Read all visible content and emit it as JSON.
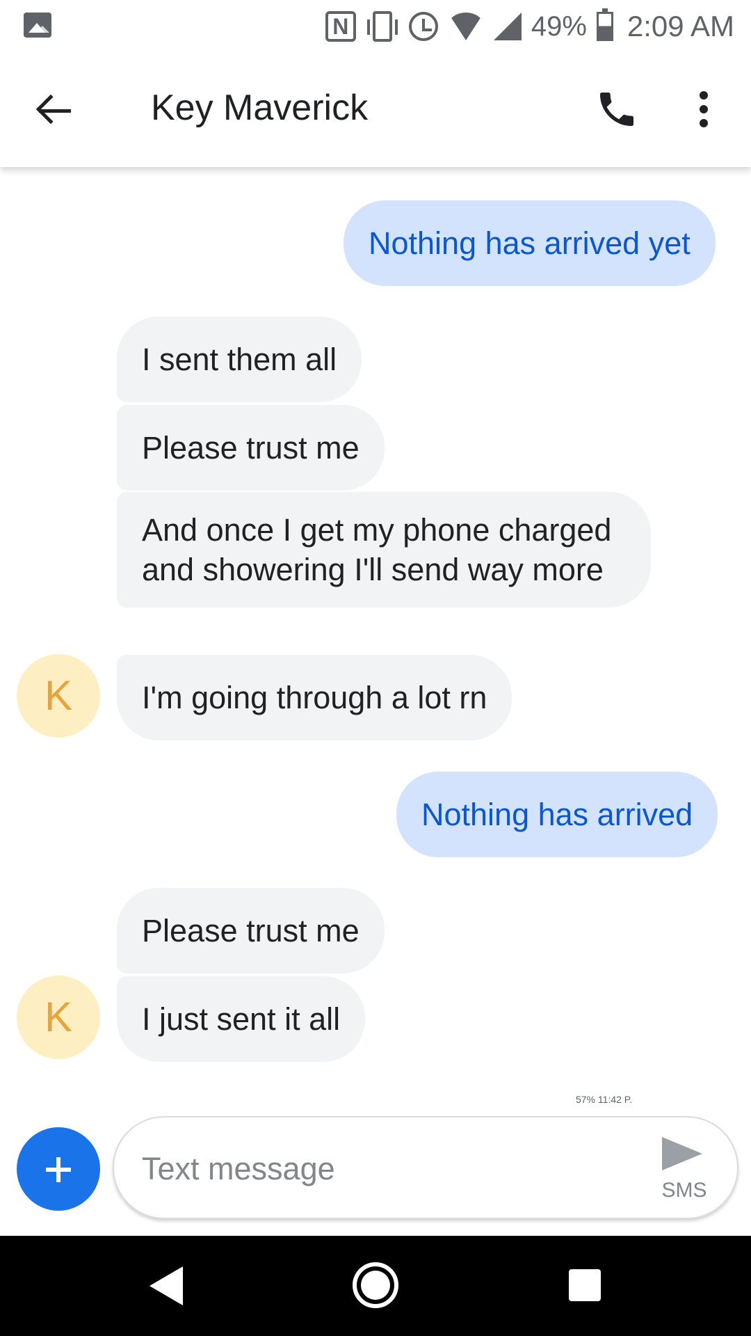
{
  "status_bar": {
    "battery_percent": "49%",
    "time": "2:09 AM",
    "icons": [
      "gallery-icon",
      "nfc-icon",
      "vibrate-icon",
      "alarm-icon",
      "wifi-icon",
      "signal-icon",
      "battery-icon"
    ]
  },
  "header": {
    "contact_name": "Key Maverick",
    "icons": [
      "back-arrow-icon",
      "phone-icon",
      "more-vert-icon"
    ]
  },
  "messages": [
    {
      "direction": "outgoing",
      "text": "Nothing has arrived yet"
    },
    {
      "direction": "incoming",
      "text": "I sent them all"
    },
    {
      "direction": "incoming",
      "text": "Please trust me"
    },
    {
      "direction": "incoming",
      "text": "And once I get my phone charged and showering I'll send way more"
    },
    {
      "direction": "incoming",
      "text": "I'm going through a lot rn"
    },
    {
      "direction": "outgoing",
      "text": "Nothing has arrived"
    },
    {
      "direction": "incoming",
      "text": "Please trust me"
    },
    {
      "direction": "incoming",
      "text": "I just sent it all"
    }
  ],
  "avatar_initial": "K",
  "mini_status": {
    "battery_percent": "57%",
    "time": "11:42 P."
  },
  "compose": {
    "placeholder": "Text message",
    "send_label": "SMS"
  },
  "colors": {
    "outgoing_bubble": "#d3e3fd",
    "outgoing_text": "#0b57d0",
    "incoming_bubble": "#f1f3f4",
    "avatar_bg": "#feefc3",
    "avatar_text": "#e8a33d",
    "fab": "#1a73e8"
  }
}
